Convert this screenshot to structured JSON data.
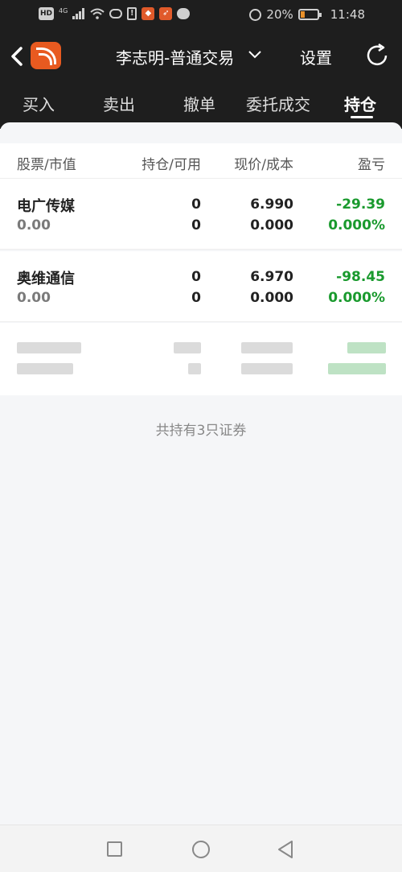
{
  "status_bar": {
    "hd_badge": "HD",
    "network": "4G",
    "battery": "20%",
    "time": "11:48"
  },
  "header": {
    "account": "李志明-普通交易",
    "settings": "设置"
  },
  "tabs": [
    {
      "label": "买入",
      "active": false
    },
    {
      "label": "卖出",
      "active": false
    },
    {
      "label": "撤单",
      "active": false
    },
    {
      "label": "委托成交",
      "active": false
    },
    {
      "label": "持仓",
      "active": true
    }
  ],
  "columns": [
    "股票/市值",
    "持仓/可用",
    "现价/成本",
    "盈亏"
  ],
  "holdings": [
    {
      "name": "电广传媒",
      "market_value": "0.00",
      "position": "0",
      "available": "0",
      "price": "6.990",
      "cost": "0.000",
      "pnl": "-29.39",
      "pnl_pct": "0.000%"
    },
    {
      "name": "奥维通信",
      "market_value": "0.00",
      "position": "0",
      "available": "0",
      "price": "6.970",
      "cost": "0.000",
      "pnl": "-98.45",
      "pnl_pct": "0.000%"
    }
  ],
  "summary": "共持有3只证券",
  "colors": {
    "header_bg": "#1e1e1e",
    "profit_green": "#1a9a2e",
    "logo_orange": "#e85a20"
  }
}
